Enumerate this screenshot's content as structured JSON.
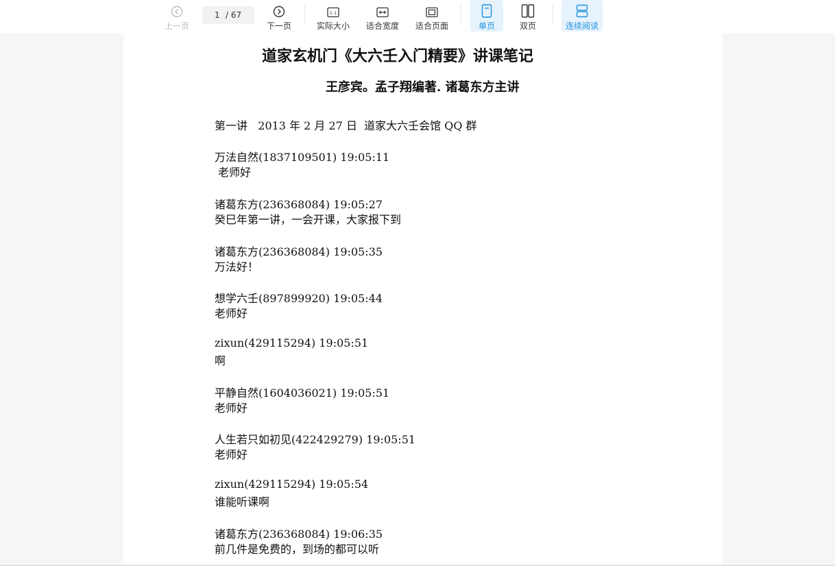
{
  "toolbar": {
    "prev_label": "上一页",
    "next_label": "下一页",
    "page_current": "1",
    "page_total": "/ 67",
    "actual_size_label": "实际大小",
    "fit_width_label": "适合宽度",
    "fit_page_label": "适合页面",
    "single_page_label": "单页",
    "double_page_label": "双页",
    "continuous_label": "连续阅读",
    "active_color": "#2192e0",
    "icons": [
      "chevron-left-icon",
      "chevron-right-icon",
      "actual-size-icon",
      "fit-width-icon",
      "fit-page-icon",
      "single-page-icon",
      "double-page-icon",
      "continuous-read-icon"
    ]
  },
  "document": {
    "title": "道家玄机门《大六壬入门精要》讲课笔记",
    "subtitle": "王彦宾。孟子翔编著. 诸葛东方主讲",
    "lecture_header": "第一讲   2013 年 2 月 27 日  道家大六壬会馆 QQ 群",
    "messages": [
      {
        "sender": "万法自然(1837109501) 19:05:11",
        "text": " 老师好"
      },
      {
        "sender": "诸葛东方(236368084) 19:05:27",
        "text": "癸巳年第一讲，一会开课，大家报下到"
      },
      {
        "sender": "诸葛东方(236368084) 19:05:35",
        "text": "万法好！"
      },
      {
        "sender": "想学六壬(897899920) 19:05:44",
        "text": "老师好"
      },
      {
        "sender": "zixun(429115294) 19:05:51",
        "text": "啊"
      },
      {
        "sender": "平静自然(1604036021) 19:05:51",
        "text": "老师好"
      },
      {
        "sender": "人生若只如初见(422429279) 19:05:51",
        "text": "老师好"
      },
      {
        "sender": "zixun(429115294) 19:05:54",
        "text": "谁能听课啊"
      },
      {
        "sender": "诸葛东方(236368084) 19:06:35",
        "text": "前几件是免费的，到场的都可以听"
      }
    ]
  }
}
